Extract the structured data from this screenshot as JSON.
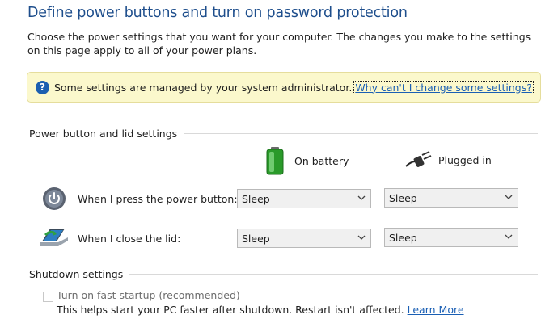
{
  "page": {
    "title": "Define power buttons and turn on password protection",
    "description": "Choose the power settings that you want for your computer. The changes you make to the settings on this page apply to all of your power plans."
  },
  "banner": {
    "message": "Some settings are managed by your system administrator.",
    "link_label": "Why can't I change some settings?"
  },
  "power_section": {
    "heading": "Power button and lid settings",
    "col_battery": "On battery",
    "col_plugged": "Plugged in",
    "rows": [
      {
        "label": "When I press the power button:",
        "battery": "Sleep",
        "plugged": "Sleep"
      },
      {
        "label": "When I close the lid:",
        "battery": "Sleep",
        "plugged": "Sleep"
      }
    ]
  },
  "shutdown_section": {
    "heading": "Shutdown settings",
    "fast_startup_label": "Turn on fast startup (recommended)",
    "fast_startup_checked": false,
    "fast_startup_desc": "This helps start your PC faster after shutdown. Restart isn't affected.",
    "learn_more": "Learn More"
  },
  "icons": {
    "info": "question-icon",
    "battery": "battery-icon",
    "plug": "power-plug-icon",
    "power_button": "power-button-icon",
    "lid": "laptop-lid-icon"
  },
  "colors": {
    "title": "#1e4e8c",
    "link": "#1a5fb4",
    "banner_bg": "#fbf8cc"
  }
}
